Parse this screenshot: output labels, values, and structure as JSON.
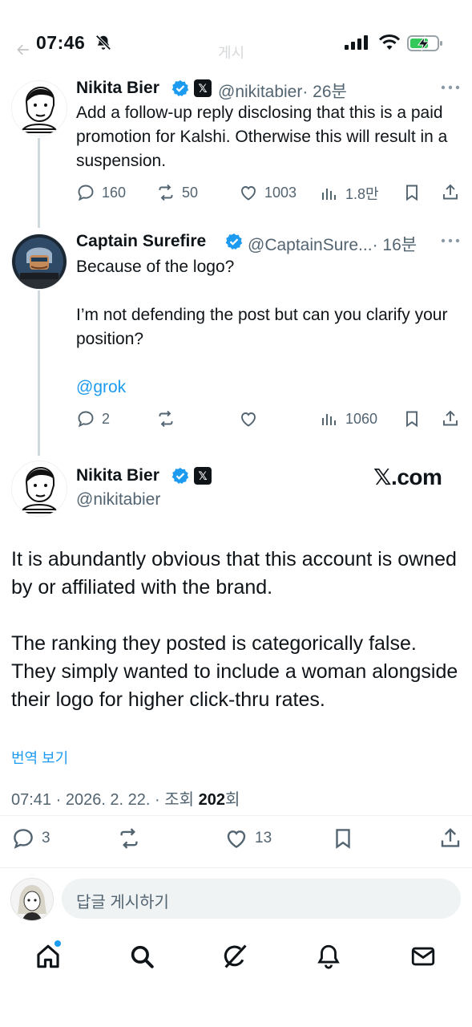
{
  "status_bar": {
    "time": "07:46",
    "ghost_title": "게시"
  },
  "tweets": [
    {
      "name": "Nikita Bier",
      "handle": "@nikitabier",
      "age": "· 26분",
      "text": "Add a follow-up reply disclosing that this is a paid promotion for Kalshi. Otherwise this will result in a suspension.",
      "replies": "160",
      "reposts": "50",
      "likes": "1003",
      "views": "1.8만"
    },
    {
      "name": "Captain Surefire",
      "handle": "@CaptainSure...",
      "age": "· 16분",
      "text_1": "Because of the logo?",
      "text_2": "I’m not defending the post but can you clarify your position?",
      "mention": "@grok",
      "replies": "2",
      "reposts": "",
      "likes": "",
      "views": "1060"
    }
  ],
  "main_tweet": {
    "name": "Nikita Bier",
    "handle": "@nikitabier",
    "watermark": "𝕏.com",
    "paragraph_1": "It is abundantly obvious that this account is owned by or affiliated with the brand.",
    "paragraph_2": "The ranking they posted is categorically false. They simply wanted to include a woman alongside their logo for higher click-thru rates.",
    "translate": "번역 보기",
    "meta_prefix": "07:41 · 2026. 2. 22. · 조회 ",
    "views": "202",
    "meta_suffix": "회",
    "replies": "3",
    "reposts": "",
    "likes": "13"
  },
  "reply_bar": {
    "placeholder": "답글 게시하기"
  },
  "nav": {
    "items": [
      "home-icon",
      "search-icon",
      "grok-icon",
      "notifications-icon",
      "messages-icon"
    ]
  },
  "colors": {
    "accent": "#1d9bf0",
    "text": "#0f1419",
    "secondary": "#536471",
    "battery": "#34c759"
  }
}
